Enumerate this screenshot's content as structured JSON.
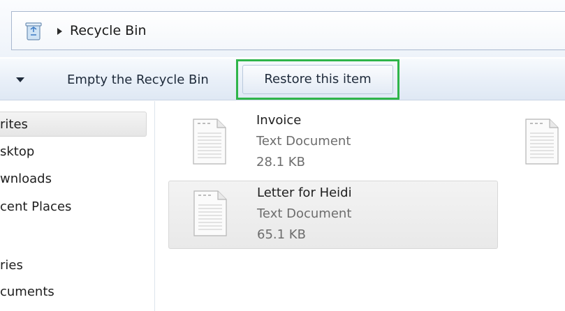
{
  "window": {
    "breadcrumb": {
      "location_label": "Recycle Bin"
    }
  },
  "toolbar": {
    "empty_label": "Empty the Recycle Bin",
    "restore_label": "Restore this item",
    "highlight_color": "#2fb54a"
  },
  "navigation": {
    "items": [
      {
        "label": "rites",
        "selected": true
      },
      {
        "label": "sktop"
      },
      {
        "label": "wnloads"
      },
      {
        "label": "cent Places"
      },
      {
        "label": "ries"
      },
      {
        "label": "cuments"
      }
    ]
  },
  "files": [
    {
      "name": "Invoice",
      "type": "Text Document",
      "size": "28.1 KB",
      "selected": false
    },
    {
      "name": "Letter for Heidi",
      "type": "Text Document",
      "size": "65.1 KB",
      "selected": true
    }
  ],
  "icons": {
    "location": "recycle-bin-icon",
    "breadcrumb_separator": "chevron-right-icon",
    "organize": "chevron-down-icon",
    "file": "text-document-icon"
  }
}
